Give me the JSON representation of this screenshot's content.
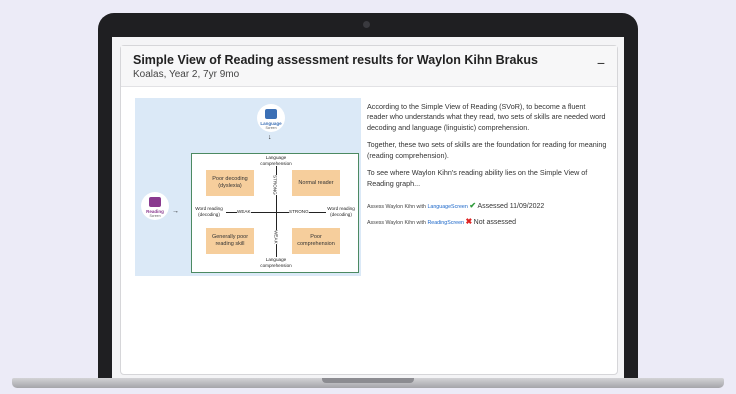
{
  "card": {
    "title": "Simple View of Reading assessment results for Waylon Kihn Brakus",
    "subtitle": "Koalas, Year 2, 7yr 9mo",
    "collapse_icon": "−"
  },
  "diagram": {
    "top_logo": {
      "name": "Language",
      "sub": "Screen"
    },
    "left_logo": {
      "name": "Reading",
      "sub": "Screen"
    },
    "quadrants": {
      "top_left": "Poor decoding (dyslexia)",
      "top_right": "Normal reader",
      "bottom_left": "Generally poor reading skill",
      "bottom_right": "Poor comprehension"
    },
    "top_label": "Language comprehension",
    "bottom_label": "Language comprehension",
    "left_label": "Word reading (decoding)",
    "right_label": "Word reading (decoding)",
    "weak_h": "WEAK",
    "strong_h": "STRONG",
    "strong_v": "STRONG",
    "weak_v": "WEAK"
  },
  "description": {
    "p1": "According to the Simple View of Reading (SVoR), to become a fluent reader who understands what they read, two sets of skills are needed word decoding and language (linguistic) comprehension.",
    "p2": "Together, these two sets of skills are the foundation for reading for meaning (reading comprehension).",
    "p3": "To see where Waylon Kihn's reading ability lies on the Simple View of Reading graph..."
  },
  "assessments": [
    {
      "prefix": "Assess Waylon Kihn with",
      "link": "LanguageScreen",
      "status_icon": "✔",
      "status": "Assessed 11/09/2022"
    },
    {
      "prefix": "Assess Waylon Kihn with",
      "link": "ReadingScreen",
      "status_icon": "✖",
      "status": "Not assessed"
    }
  ],
  "colors": {
    "accent": "#1a66c9",
    "quadrant": "#f6ce9c",
    "diagram_bg": "#dbe9f7",
    "assessed": "#2f9a3a",
    "not_assessed": "#dd2222"
  }
}
